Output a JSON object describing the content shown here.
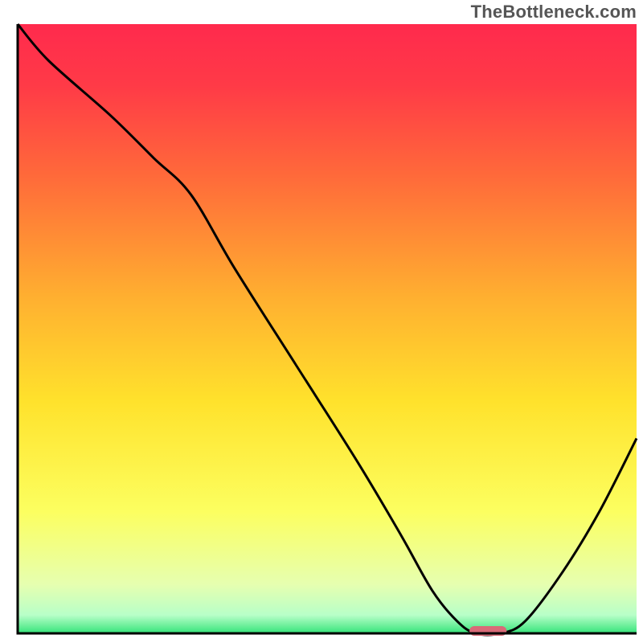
{
  "watermark": "TheBottleneck.com",
  "colors": {
    "curve_stroke": "#000000",
    "axis_stroke": "#000000",
    "marker_fill": "#d96a78"
  },
  "chart_data": {
    "type": "line",
    "title": "",
    "xlabel": "",
    "ylabel": "",
    "xlim": [
      0,
      100
    ],
    "ylim": [
      0,
      100
    ],
    "annotations": [],
    "gradient_stops": [
      {
        "offset": 0.0,
        "color": "#ff2a4d"
      },
      {
        "offset": 0.1,
        "color": "#ff3a47"
      },
      {
        "offset": 0.25,
        "color": "#ff6a3a"
      },
      {
        "offset": 0.45,
        "color": "#ffb030"
      },
      {
        "offset": 0.62,
        "color": "#ffe22c"
      },
      {
        "offset": 0.8,
        "color": "#fcff60"
      },
      {
        "offset": 0.92,
        "color": "#e6ffb0"
      },
      {
        "offset": 0.97,
        "color": "#b8ffc8"
      },
      {
        "offset": 1.0,
        "color": "#35e47a"
      }
    ],
    "curve": {
      "name": "bottleneck-curve",
      "x": [
        0,
        5,
        15,
        22,
        28,
        35,
        45,
        55,
        62,
        67,
        71,
        74,
        78,
        82,
        88,
        94,
        100
      ],
      "y": [
        100,
        94,
        85,
        78,
        72,
        60,
        44,
        28,
        16,
        7,
        2,
        0,
        0,
        2,
        10,
        20,
        32
      ]
    },
    "optimal_marker": {
      "x_center": 76,
      "y": 0,
      "width": 6
    }
  }
}
